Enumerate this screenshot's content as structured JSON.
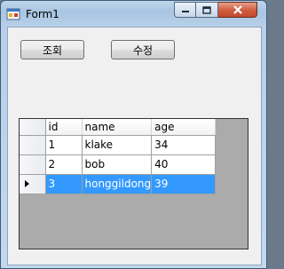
{
  "window": {
    "title": "Form1"
  },
  "toolbar": {
    "query_label": "조회",
    "edit_label": "수정"
  },
  "grid": {
    "columns": [
      "id",
      "name",
      "age"
    ],
    "rows": [
      {
        "id": "1",
        "name": "klake",
        "age": "34"
      },
      {
        "id": "2",
        "name": "bob",
        "age": "40"
      },
      {
        "id": "3",
        "name": "honggildong",
        "age": "39"
      }
    ],
    "selected_row": 3
  },
  "colors": {
    "selection": "#3399ff",
    "grid_background": "#ababab",
    "client_background": "#f0f0f0"
  }
}
